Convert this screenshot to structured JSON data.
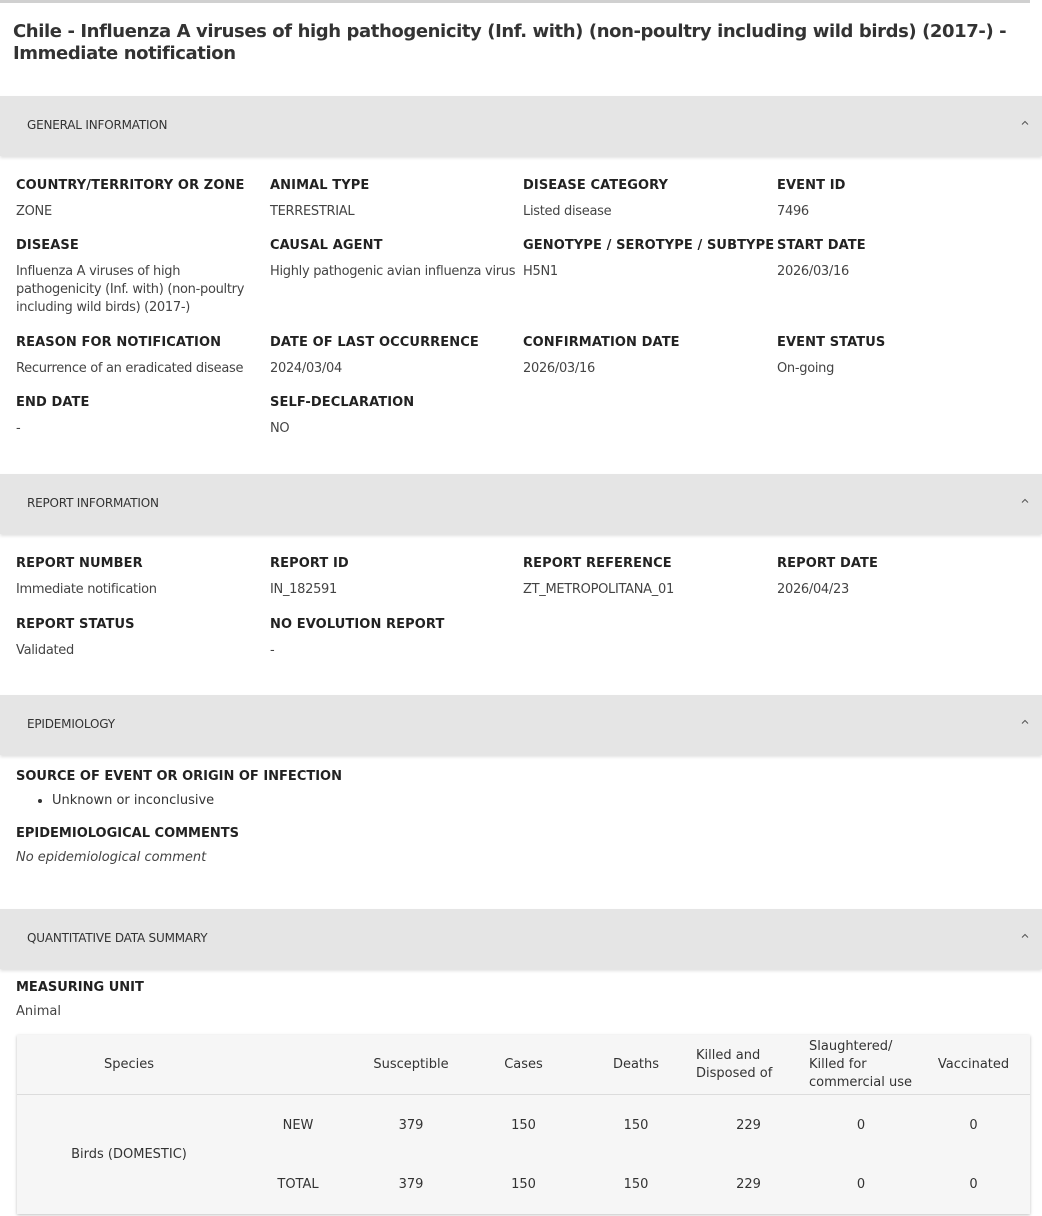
{
  "page": {
    "title": "Chile - Influenza A viruses of high pathogenicity (Inf. with) (non-poultry including wild birds) (2017-) - Immediate notification"
  },
  "icons": {
    "collapse": "chevron-up-icon"
  },
  "general": {
    "header": "GENERAL INFORMATION",
    "fields": [
      {
        "label": "COUNTRY/TERRITORY OR ZONE",
        "value": "ZONE"
      },
      {
        "label": "ANIMAL TYPE",
        "value": "TERRESTRIAL"
      },
      {
        "label": "DISEASE CATEGORY",
        "value": "Listed disease"
      },
      {
        "label": "EVENT ID",
        "value": "7496"
      },
      {
        "label": "DISEASE",
        "value": "Influenza A viruses of high pathogenicity (Inf. with) (non-poultry including wild birds) (2017-)"
      },
      {
        "label": "CAUSAL AGENT",
        "value": "Highly pathogenic avian influenza virus"
      },
      {
        "label": "GENOTYPE / SEROTYPE / SUBTYPE",
        "value": "H5N1"
      },
      {
        "label": "START DATE",
        "value": "2026/03/16"
      },
      {
        "label": "REASON FOR NOTIFICATION",
        "value": "Recurrence of an eradicated disease"
      },
      {
        "label": "DATE OF LAST OCCURRENCE",
        "value": "2024/03/04"
      },
      {
        "label": "CONFIRMATION DATE",
        "value": "2026/03/16"
      },
      {
        "label": "EVENT STATUS",
        "value": "On-going"
      },
      {
        "label": "END DATE",
        "value": "-"
      },
      {
        "label": "SELF-DECLARATION",
        "value": "NO"
      }
    ]
  },
  "report": {
    "header": "REPORT INFORMATION",
    "fields": [
      {
        "label": "REPORT NUMBER",
        "value": "Immediate notification"
      },
      {
        "label": "REPORT ID",
        "value": "IN_182591"
      },
      {
        "label": "REPORT REFERENCE",
        "value": "ZT_METROPOLITANA_01"
      },
      {
        "label": "REPORT DATE",
        "value": "2026/04/23"
      },
      {
        "label": "REPORT STATUS",
        "value": "Validated"
      },
      {
        "label": "NO EVOLUTION REPORT",
        "value": "-"
      }
    ]
  },
  "epidemiology": {
    "header": "EPIDEMIOLOGY",
    "source_label": "SOURCE OF EVENT OR ORIGIN OF INFECTION",
    "sources": [
      "Unknown or inconclusive"
    ],
    "comments_label": "EPIDEMIOLOGICAL COMMENTS",
    "comments_value": "No epidemiological comment"
  },
  "quantitative": {
    "header": "QUANTITATIVE DATA SUMMARY",
    "unit_label": "MEASURING UNIT",
    "unit_value": "Animal",
    "columns": {
      "species": "Species",
      "susceptible": "Susceptible",
      "cases": "Cases",
      "deaths": "Deaths",
      "killed": "Killed and Disposed of",
      "slaughtered": "Slaughtered/ Killed for commercial use",
      "vaccinated": "Vaccinated"
    },
    "rows": [
      {
        "species": "Birds (DOMESTIC)",
        "type": "NEW",
        "susceptible": "379",
        "cases": "150",
        "deaths": "150",
        "killed": "229",
        "slaughtered": "0",
        "vaccinated": "0"
      },
      {
        "type": "TOTAL",
        "susceptible": "379",
        "cases": "150",
        "deaths": "150",
        "killed": "229",
        "slaughtered": "0",
        "vaccinated": "0"
      }
    ]
  }
}
